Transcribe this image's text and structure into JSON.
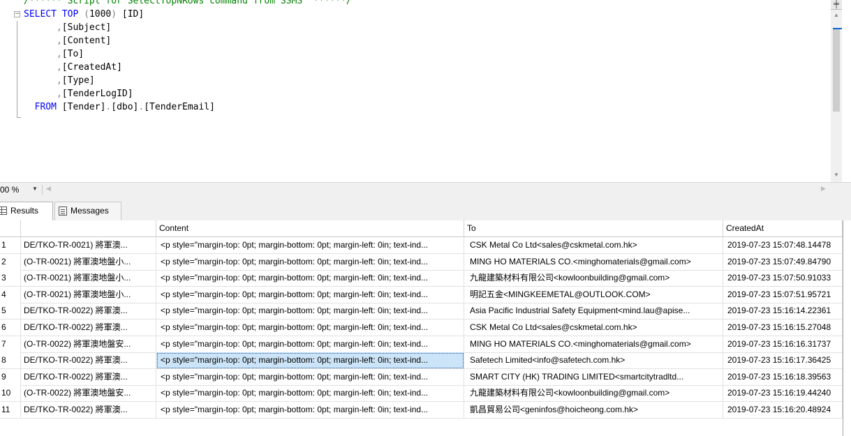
{
  "editor": {
    "lines": [
      {
        "parts": [
          {
            "t": "/****** Script for SelectTopNRows command from SSMS  ******/",
            "c": "cm"
          }
        ]
      },
      {
        "parts": [
          {
            "t": "SELECT",
            "c": "kw"
          },
          {
            "t": " ",
            "c": ""
          },
          {
            "t": "TOP",
            "c": "kw"
          },
          {
            "t": " (",
            "c": "gray"
          },
          {
            "t": "1000",
            "c": "num"
          },
          {
            "t": ") ",
            "c": "gray"
          },
          {
            "t": "[ID]",
            "c": ""
          }
        ]
      },
      {
        "parts": [
          {
            "t": "      ,",
            "c": "gray"
          },
          {
            "t": "[Subject]",
            "c": ""
          }
        ]
      },
      {
        "parts": [
          {
            "t": "      ,",
            "c": "gray"
          },
          {
            "t": "[Content]",
            "c": ""
          }
        ]
      },
      {
        "parts": [
          {
            "t": "      ,",
            "c": "gray"
          },
          {
            "t": "[To]",
            "c": ""
          }
        ]
      },
      {
        "parts": [
          {
            "t": "      ,",
            "c": "gray"
          },
          {
            "t": "[CreatedAt]",
            "c": ""
          }
        ]
      },
      {
        "parts": [
          {
            "t": "      ,",
            "c": "gray"
          },
          {
            "t": "[Type]",
            "c": ""
          }
        ]
      },
      {
        "parts": [
          {
            "t": "      ,",
            "c": "gray"
          },
          {
            "t": "[TenderLogID]",
            "c": ""
          }
        ]
      },
      {
        "parts": [
          {
            "t": "  ",
            "c": ""
          },
          {
            "t": "FROM",
            "c": "kw"
          },
          {
            "t": " [Tender]",
            "c": ""
          },
          {
            "t": ".",
            "c": "gray"
          },
          {
            "t": "[dbo]",
            "c": ""
          },
          {
            "t": ".",
            "c": "gray"
          },
          {
            "t": "[TenderEmail]",
            "c": ""
          }
        ]
      }
    ]
  },
  "zoom": {
    "level": "00 %"
  },
  "tabs": {
    "results": "Results",
    "messages": "Messages"
  },
  "grid": {
    "headers": {
      "num": "",
      "subject": "",
      "content": "Content",
      "to": "To",
      "created": "CreatedAt"
    },
    "selected_row": 7,
    "rows": [
      {
        "n": "1",
        "subject": "DE/TKO-TR-0021) 將軍澳...",
        "content": "<p style=\"margin-top: 0pt; margin-bottom: 0pt; margin-left: 0in; text-ind...",
        "to": "CSK Metal Co Ltd<sales@cskmetal.com.hk>",
        "created": "2019-07-23 15:07:48.14478"
      },
      {
        "n": "2",
        "subject": "(O-TR-0021) 將軍澳地盤小...",
        "content": "<p style=\"margin-top: 0pt; margin-bottom: 0pt; margin-left: 0in; text-ind...",
        "to": "MING HO MATERIALS CO.<minghomaterials@gmail.com>",
        "created": "2019-07-23 15:07:49.84790"
      },
      {
        "n": "3",
        "subject": "(O-TR-0021) 將軍澳地盤小...",
        "content": "<p style=\"margin-top: 0pt; margin-bottom: 0pt; margin-left: 0in; text-ind...",
        "to": "九龍建築材料有限公司<kowloonbuilding@gmail.com>",
        "created": "2019-07-23 15:07:50.91033"
      },
      {
        "n": "4",
        "subject": "(O-TR-0021) 將軍澳地盤小...",
        "content": "<p style=\"margin-top: 0pt; margin-bottom: 0pt; margin-left: 0in; text-ind...",
        "to": "明記五金<MINGKEEMETAL@OUTLOOK.COM>",
        "created": "2019-07-23 15:07:51.95721"
      },
      {
        "n": "5",
        "subject": "DE/TKO-TR-0022) 將軍澳...",
        "content": "<p style=\"margin-top: 0pt; margin-bottom: 0pt; margin-left: 0in; text-ind...",
        "to": "Asia Pacific Industrial Safety Equipment<mind.lau@apise...",
        "created": "2019-07-23 15:16:14.22361"
      },
      {
        "n": "6",
        "subject": "DE/TKO-TR-0022) 將軍澳...",
        "content": "<p style=\"margin-top: 0pt; margin-bottom: 0pt; margin-left: 0in; text-ind...",
        "to": "CSK Metal Co Ltd<sales@cskmetal.com.hk>",
        "created": "2019-07-23 15:16:15.27048"
      },
      {
        "n": "7",
        "subject": "(O-TR-0022) 將軍澳地盤安...",
        "content": "<p style=\"margin-top: 0pt; margin-bottom: 0pt; margin-left: 0in; text-ind...",
        "to": "MING HO MATERIALS CO.<minghomaterials@gmail.com>",
        "created": "2019-07-23 15:16:16.31737"
      },
      {
        "n": "8",
        "subject": "DE/TKO-TR-0022) 將軍澳...",
        "content": "<p style=\"margin-top: 0pt; margin-bottom: 0pt; margin-left: 0in; text-ind...",
        "to": "Safetech Limited<info@safetech.com.hk>",
        "created": "2019-07-23 15:16:17.36425"
      },
      {
        "n": "9",
        "subject": "DE/TKO-TR-0022) 將軍澳...",
        "content": "<p style=\"margin-top: 0pt; margin-bottom: 0pt; margin-left: 0in; text-ind...",
        "to": "SMART CITY (HK) TRADING LIMITED<smartcitytradltd...",
        "created": "2019-07-23 15:16:18.39563"
      },
      {
        "n": "10",
        "subject": "(O-TR-0022) 將軍澳地盤安...",
        "content": "<p style=\"margin-top: 0pt; margin-bottom: 0pt; margin-left: 0in; text-ind...",
        "to": "九龍建築材料有限公司<kowloonbuilding@gmail.com>",
        "created": "2019-07-23 15:16:19.44240"
      },
      {
        "n": "11",
        "subject": "DE/TKO-TR-0022) 將軍澳...",
        "content": "<p style=\"margin-top: 0pt; margin-bottom: 0pt; margin-left: 0in; text-ind...",
        "to": "凱昌貿易公司<geninfos@hoicheong.com.hk>",
        "created": "2019-07-23 15:16:20.48924"
      }
    ]
  }
}
